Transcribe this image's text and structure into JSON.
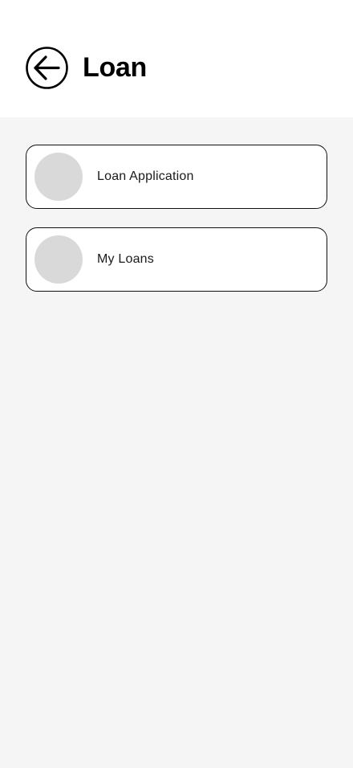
{
  "header": {
    "title": "Loan",
    "back_icon": "arrow-left-circle-icon"
  },
  "menu": {
    "items": [
      {
        "label": "Loan Application",
        "icon": "placeholder-circle"
      },
      {
        "label": "My Loans",
        "icon": "placeholder-circle"
      }
    ]
  },
  "colors": {
    "header_background": "#ffffff",
    "page_background": "#f5f5f5",
    "card_background": "#ffffff",
    "card_border": "#111111",
    "avatar_placeholder": "#d9d9d9"
  }
}
